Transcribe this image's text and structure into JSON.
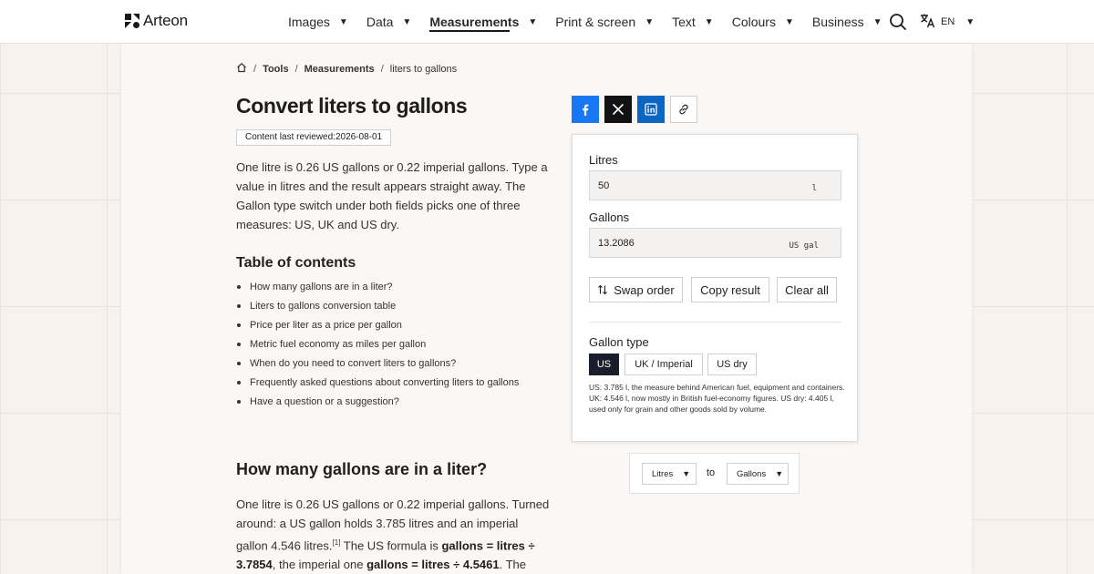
{
  "header": {
    "logo_text": "Arteon",
    "nav": [
      {
        "label": "Images"
      },
      {
        "label": "Data"
      },
      {
        "label": "Measurements"
      },
      {
        "label": "Print & screen"
      },
      {
        "label": "Text"
      },
      {
        "label": "Colours"
      },
      {
        "label": "Business"
      }
    ],
    "active_nav": "Measurements",
    "lang": "EN",
    "icons": {
      "search": "search-icon",
      "translate": "translate-icon",
      "home": "home-icon"
    }
  },
  "breadcrumb": {
    "items": [
      "Tools",
      "Measurements"
    ],
    "current": "liters to gallons"
  },
  "page": {
    "title": "Convert liters to gallons",
    "reviewed": "Content last reviewed:2026-08-01",
    "intro": "One litre is 0.26 US gallons or 0.22 imperial gallons. Type a value in litres and the result appears straight away. The Gallon type switch under both fields picks one of three measures: US, UK and US dry.",
    "toc_title": "Table of contents",
    "toc": [
      "How many gallons are in a liter?",
      "Liters to gallons conversion table",
      "Price per liter as a price per gallon",
      "Metric fuel economy as miles per gallon",
      "When do you need to convert liters to gallons?",
      "Frequently asked questions about converting liters to gallons",
      "Have a question or a suggestion?"
    ],
    "section_title": "How many gallons are in a liter?",
    "section": {
      "p1": "One litre is 0.26 US gallons or 0.22 imperial gallons. Turned around: a US gallon holds 3.785 litres and an imperial gallon 4.546 litres.",
      "ref": "[1]",
      "p2": " The US formula is ",
      "f1": "gallons = litres ÷ 3.7854",
      "p3": ", the imperial one ",
      "f2": "gallons = litres ÷ 4.5461",
      "p4": ". The third"
    }
  },
  "share": [
    "facebook-icon",
    "x-icon",
    "linkedin-icon",
    "link-icon"
  ],
  "converter": {
    "litres_label": "Litres",
    "litres_value": "50",
    "litres_unit": "l",
    "gallons_label": "Gallons",
    "gallons_value": "13.2086",
    "gallons_unit": "US gal",
    "swap_label": "Swap order",
    "copy_label": "Copy result",
    "clear_label": "Clear all",
    "gallon_type_label": "Gallon type",
    "gallon_types": [
      "US",
      "UK / Imperial",
      "US dry"
    ],
    "selected_type": "US",
    "note": "US: 3.785 l, the measure behind American fuel, equipment and containers. UK: 4.546 l, now mostly in British fuel-economy figures. US dry: 4.405 l, used only for grain and other goods sold by volume."
  },
  "unit_pair": {
    "from": "Litres",
    "to_word": "to",
    "to": "Gallons"
  },
  "colors": {
    "facebook": "#1877f2",
    "x": "#121212",
    "linkedin": "#0a66c2",
    "active_segment": "#1b1e2a"
  }
}
